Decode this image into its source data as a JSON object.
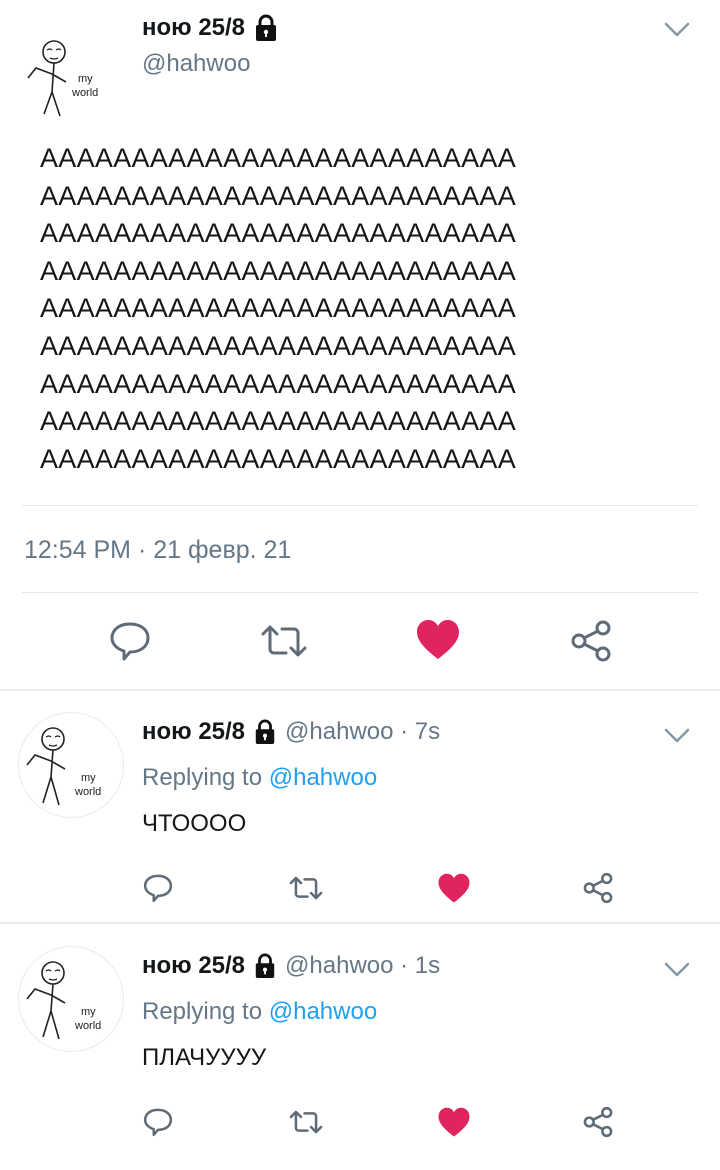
{
  "main_tweet": {
    "display_name": "ною 25/8",
    "handle": "@hahwoo",
    "avatar_text_top": "my",
    "avatar_text_bottom": "world",
    "text_lines": [
      "АААААААААААААААААААААААААА",
      "АААААААААААААААААААААААААА",
      "АААААААААААААААААААААААААА",
      "АААААААААААААААААААААААААА",
      "АААААААААААААААААААААААААА",
      "АААААААААААААААААААААААААА",
      "АААААААААААААААААААААААААА",
      "АААААААААААААААААААААААААА",
      "АААААААААААААААААААААААААА"
    ],
    "timestamp": "12:54 PM · 21 февр. 21",
    "liked": true,
    "icons": [
      "chevron-down-icon",
      "lock-icon",
      "reply-icon",
      "retweet-icon",
      "heart-icon",
      "share-icon"
    ]
  },
  "replies": [
    {
      "display_name": "ною 25/8",
      "handle_time": "@hahwoo · 7s",
      "replying_label": "Replying to",
      "replying_to": "@hahwoo",
      "text": "ЧТОООО",
      "liked": true
    },
    {
      "display_name": "ною 25/8",
      "handle_time": "@hahwoo · 1s",
      "replying_label": "Replying to",
      "replying_to": "@hahwoo",
      "text": "ПЛАЧУУУУ",
      "liked": true
    }
  ],
  "colors": {
    "heart": "#e0245e",
    "mention": "#1da1f2",
    "secondary_text": "#657786",
    "divider": "#e1e8ed"
  }
}
